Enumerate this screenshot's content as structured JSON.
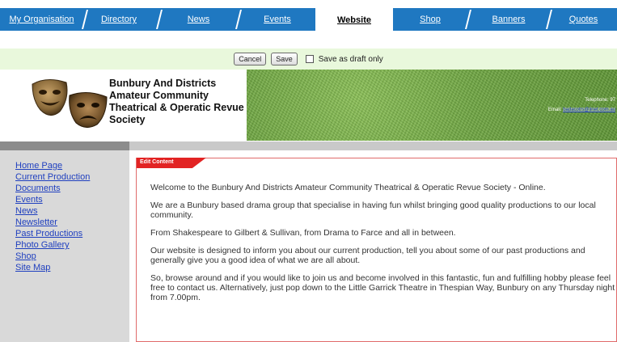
{
  "tabs": [
    {
      "label": "My Organisation",
      "active": false
    },
    {
      "label": "Directory",
      "active": false
    },
    {
      "label": "News",
      "active": false
    },
    {
      "label": "Events",
      "active": false
    },
    {
      "label": "Website",
      "active": true
    },
    {
      "label": "Shop",
      "active": false
    },
    {
      "label": "Banners",
      "active": false
    },
    {
      "label": "Quotes",
      "active": false
    }
  ],
  "actions": {
    "cancel_label": "Cancel",
    "save_label": "Save",
    "draft_label": "Save as draft only",
    "draft_checked": false
  },
  "banner": {
    "org_name": "Bunbury And Districts Amateur Community Theatrical & Operatic Revue Society",
    "telephone_label": "Telephone: 97",
    "email_label": "Email:",
    "email_link": "badacotrs@iinet.com.au"
  },
  "sidebar": {
    "items": [
      {
        "label": "Home Page"
      },
      {
        "label": "Current Production"
      },
      {
        "label": "Documents"
      },
      {
        "label": "Events"
      },
      {
        "label": "News"
      },
      {
        "label": "Newsletter"
      },
      {
        "label": "Past Productions"
      },
      {
        "label": "Photo Gallery"
      },
      {
        "label": "Shop"
      },
      {
        "label": "Site Map"
      }
    ]
  },
  "content": {
    "edit_tag": "Edit Content",
    "paragraphs": [
      "Welcome to the Bunbury And Districts Amateur Community Theatrical & Operatic Revue Society - Online.",
      "We are a Bunbury based drama group that specialise in having fun whilst bringing good quality productions to our local community.",
      "From Shakespeare to Gilbert & Sullivan, from Drama to Farce and all in between.",
      "Our website is designed to inform you about our current production, tell you about some of our past productions and generally give you a good idea of what we are all about.",
      "So, browse around and if you would like to join us and become involved in this fantastic, fun and fulfilling hobby please feel free to contact us.  Alternatively, just pop down to the Little Garrick Theatre in Thespian Way, Bunbury on any Thursday night from 7.00pm."
    ]
  },
  "colors": {
    "tab_blue": "#1f78c1",
    "link_blue": "#1f3fbf",
    "edit_red": "#e22323",
    "action_bg": "#e9f8dc"
  }
}
